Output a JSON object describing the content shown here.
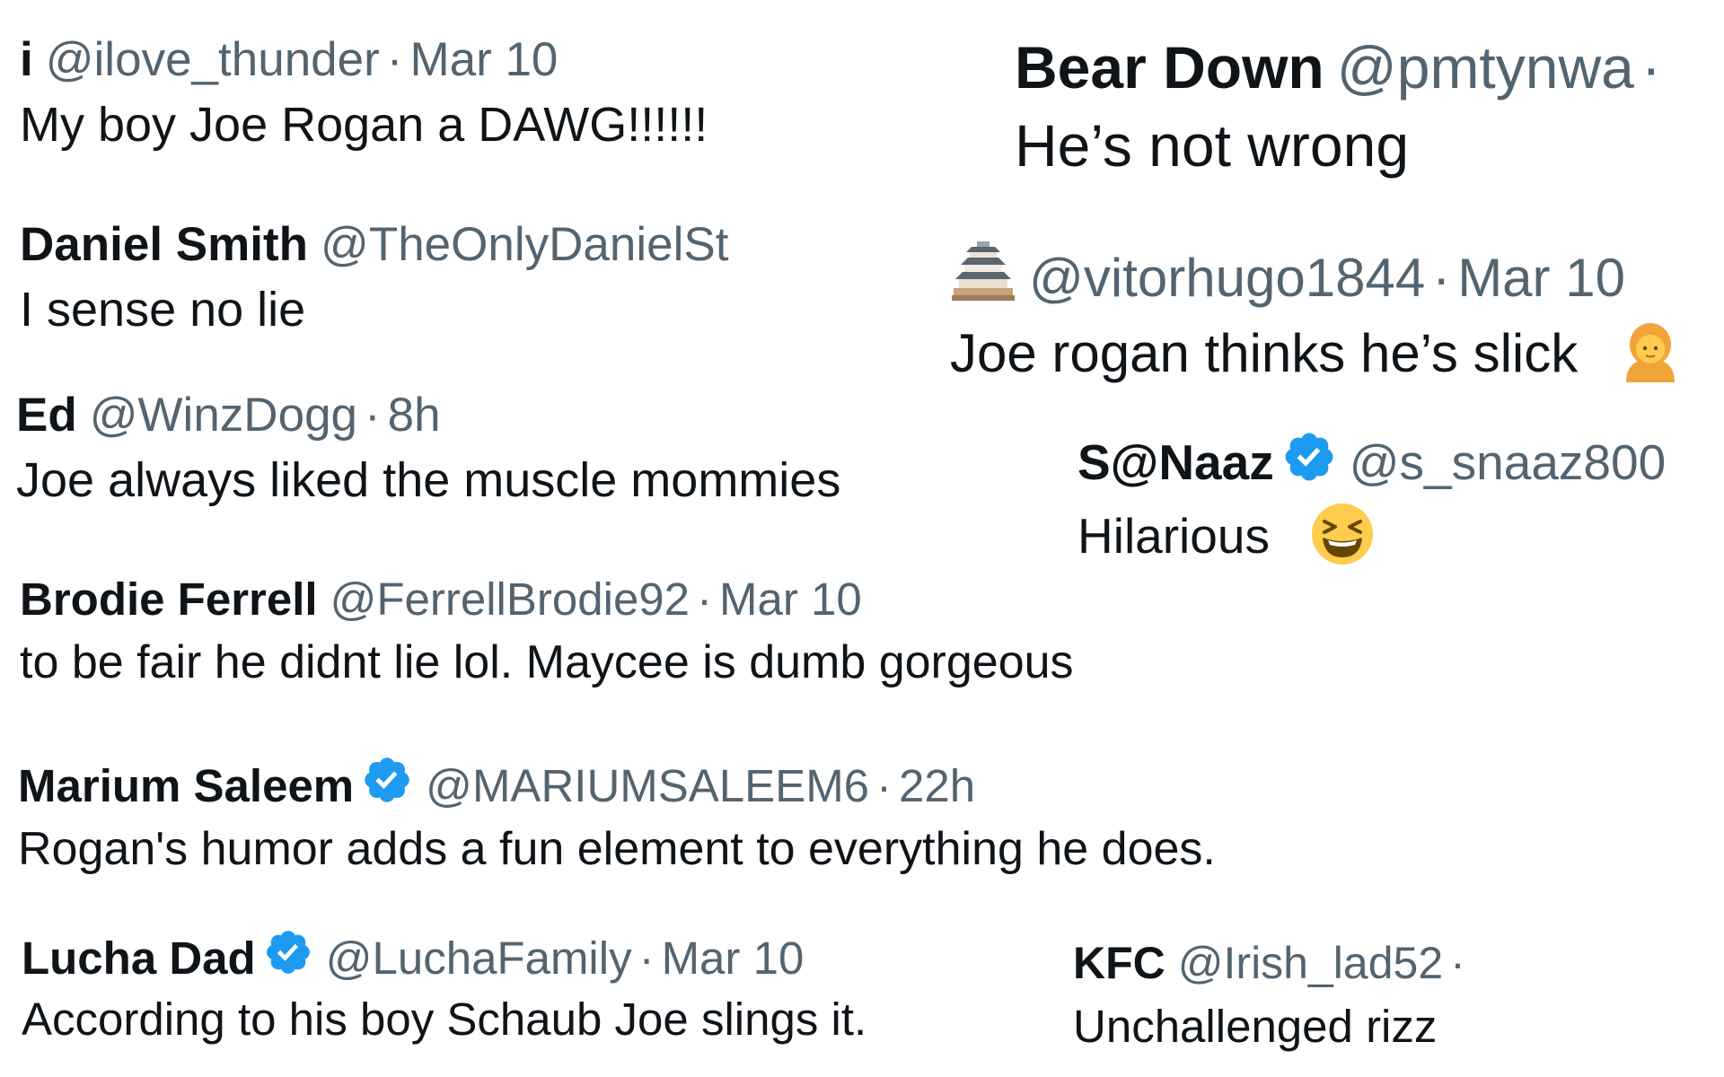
{
  "tweets": [
    {
      "name": "i",
      "handle": "@ilove_thunder",
      "separator": "·",
      "time": "Mar 10",
      "text": "My boy Joe Rogan a DAWG!!!!!!",
      "verified": false
    },
    {
      "name": "Bear Down",
      "handle": "@pmtynwa",
      "separator": "·",
      "time": "",
      "text": "He’s not wrong",
      "verified": false
    },
    {
      "name": "Daniel Smith",
      "handle": "@TheOnlyDanielSt",
      "separator": "",
      "time": "",
      "text": "I sense no lie",
      "verified": false
    },
    {
      "name": "",
      "avatar_icon": "japanese-castle-emoji-icon",
      "handle": "@vitorhugo1844",
      "separator": "·",
      "time": "Mar 10",
      "text": "Joe rogan thinks he’s slick",
      "text_emoji": "person-emoji-icon",
      "verified": false
    },
    {
      "name": "Ed",
      "handle": "@WinzDogg",
      "separator": "·",
      "time": "8h",
      "text": "Joe always liked the muscle mommies",
      "verified": false
    },
    {
      "name": "S@Naaz",
      "handle": "@s_snaaz800",
      "separator": "",
      "time": "",
      "text": "Hilarious",
      "text_emoji": "laughing-face-emoji-icon",
      "verified": true
    },
    {
      "name": "Brodie Ferrell",
      "handle": "@FerrellBrodie92",
      "separator": "·",
      "time": "Mar 10",
      "text": "to be fair he didnt lie lol. Maycee is dumb gorgeous",
      "verified": false
    },
    {
      "name": "Marium Saleem",
      "handle": "@MARIUMSALEEM6",
      "separator": "·",
      "time": "22h",
      "text": "Rogan's humor adds a fun element to everything he does.",
      "verified": true
    },
    {
      "name": "Lucha Dad",
      "handle": "@LuchaFamily",
      "separator": "·",
      "time": "Mar 10",
      "text": "According to his boy Schaub Joe slings it.",
      "verified": true
    },
    {
      "name": "KFC",
      "handle": "@Irish_lad52",
      "separator": "·",
      "time": "",
      "text": "Unchallenged rizz",
      "verified": false
    }
  ],
  "colors": {
    "name": "#0f1419",
    "handle": "#536471",
    "verified": "#1d9bf0",
    "background": "#ffffff"
  }
}
